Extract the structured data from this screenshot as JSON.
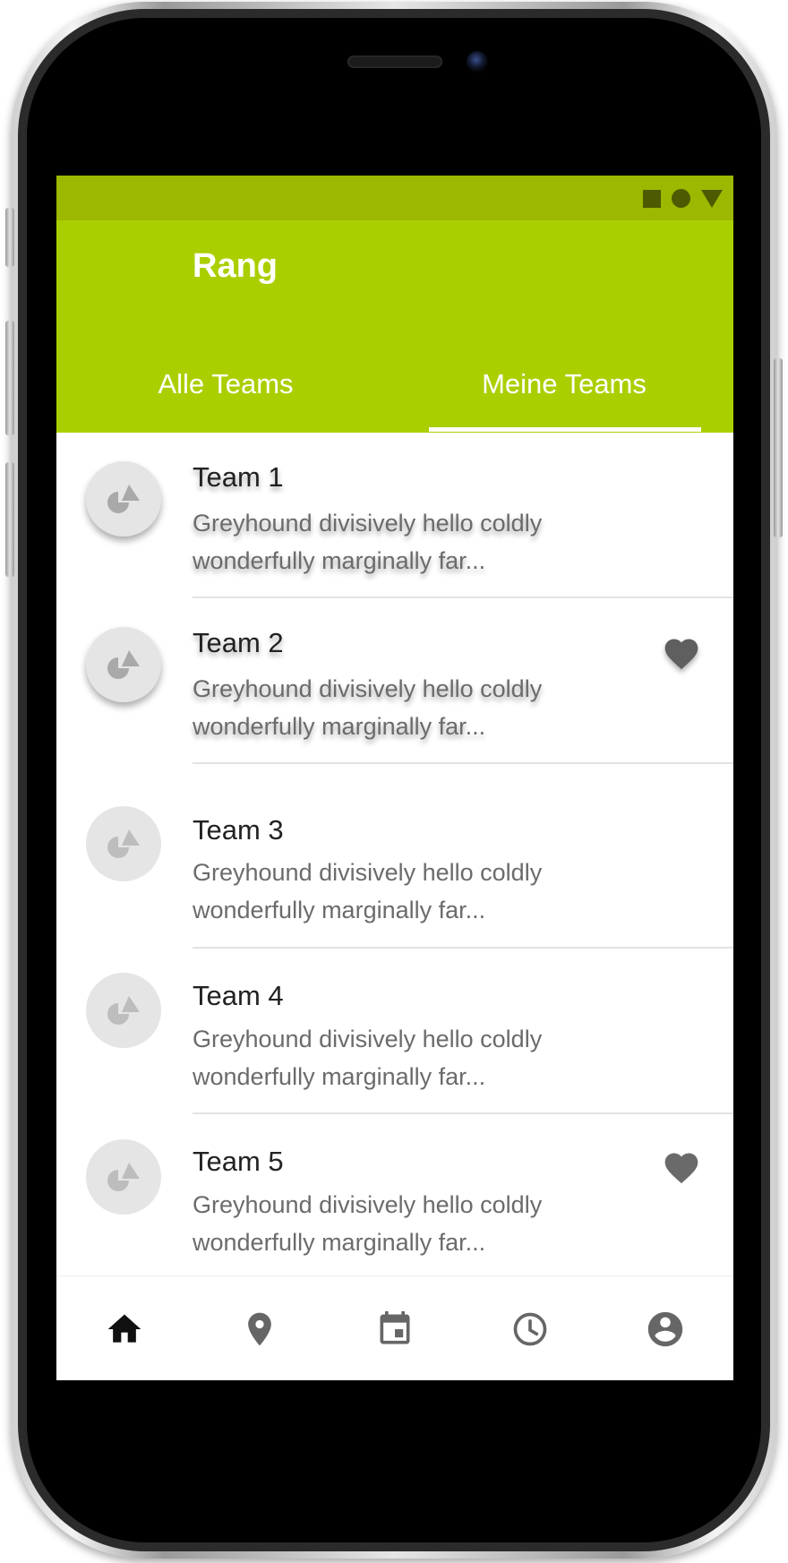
{
  "app": {
    "title": "Rang",
    "accent_color": "#aacf00",
    "status_bar_color": "#9cb800"
  },
  "status_bar": {
    "icons": [
      "stop-square-icon",
      "record-circle-icon",
      "signal-triangle-icon"
    ]
  },
  "tabs": [
    {
      "label": "Alle Teams",
      "selected": false
    },
    {
      "label": "Meine Teams",
      "selected": true
    }
  ],
  "teams": [
    {
      "name": "Team 1",
      "subtitle_line1": "Greyhound divisively hello coldly",
      "subtitle_line2": "wonderfully marginally far...",
      "favorite": false
    },
    {
      "name": "Team 2",
      "subtitle_line1": "Greyhound divisively hello coldly",
      "subtitle_line2": "wonderfully marginally far...",
      "favorite": true
    },
    {
      "name": "Team 3",
      "subtitle_line1": "Greyhound divisively hello coldly",
      "subtitle_line2": "wonderfully marginally far...",
      "favorite": false
    },
    {
      "name": "Team 4",
      "subtitle_line1": "Greyhound divisively hello coldly",
      "subtitle_line2": "wonderfully marginally far...",
      "favorite": false
    },
    {
      "name": "Team 5",
      "subtitle_line1": "Greyhound divisively hello coldly",
      "subtitle_line2": "wonderfully marginally far...",
      "favorite": true
    }
  ],
  "bottom_nav": [
    {
      "icon": "home-icon",
      "active": true
    },
    {
      "icon": "location-pin-icon",
      "active": false
    },
    {
      "icon": "calendar-icon",
      "active": false
    },
    {
      "icon": "clock-icon",
      "active": false
    },
    {
      "icon": "account-circle-icon",
      "active": false
    }
  ]
}
